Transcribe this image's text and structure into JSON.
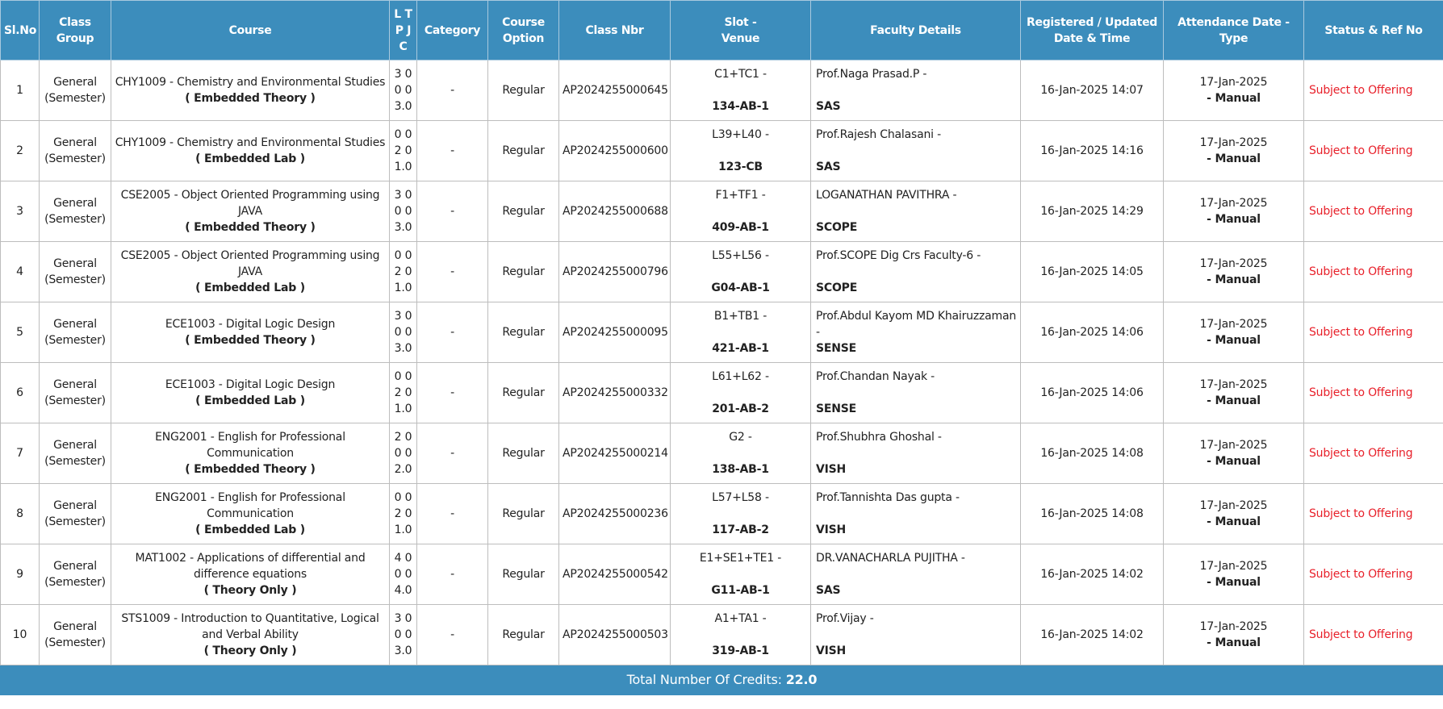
{
  "headers": {
    "slno": "Sl.No",
    "class_group_1": "Class",
    "class_group_2": "Group",
    "course": "Course",
    "ltpc_1": "L T",
    "ltpc_2": "P J",
    "ltpc_3": "C",
    "category": "Category",
    "course_option_1": "Course",
    "course_option_2": "Option",
    "class_nbr": "Class Nbr",
    "slot_venue_1": "Slot -",
    "slot_venue_2": "Venue",
    "faculty": "Faculty Details",
    "registered_1": "Registered / Updated",
    "registered_2": "Date & Time",
    "attendance": "Attendance Date - Type",
    "status": "Status & Ref No"
  },
  "rows": [
    {
      "sl": "1",
      "group1": "General",
      "group2": "(Semester)",
      "course": "CHY1009 - Chemistry and Environmental Studies",
      "course_type": "( Embedded Theory )",
      "ltpc": [
        "3 0",
        "0 0",
        "3.0"
      ],
      "category": "-",
      "option": "Regular",
      "class_nbr": "AP2024255000645",
      "slot": "C1+TC1 -",
      "venue": "134-AB-1",
      "faculty": "Prof.Naga Prasad.P -",
      "school": "SAS",
      "registered": "16-Jan-2025 14:07",
      "att_date": "17-Jan-2025",
      "att_type": "- Manual",
      "status": "Subject to Offering"
    },
    {
      "sl": "2",
      "group1": "General",
      "group2": "(Semester)",
      "course": "CHY1009 - Chemistry and Environmental Studies",
      "course_type": "( Embedded Lab )",
      "ltpc": [
        "0 0",
        "2 0",
        "1.0"
      ],
      "category": "-",
      "option": "Regular",
      "class_nbr": "AP2024255000600",
      "slot": "L39+L40 -",
      "venue": "123-CB",
      "faculty": "Prof.Rajesh Chalasani -",
      "school": "SAS",
      "registered": "16-Jan-2025 14:16",
      "att_date": "17-Jan-2025",
      "att_type": "- Manual",
      "status": "Subject to Offering"
    },
    {
      "sl": "3",
      "group1": "General",
      "group2": "(Semester)",
      "course": "CSE2005 - Object Oriented Programming using JAVA",
      "course_type": "( Embedded Theory )",
      "ltpc": [
        "3 0",
        "0 0",
        "3.0"
      ],
      "category": "-",
      "option": "Regular",
      "class_nbr": "AP2024255000688",
      "slot": "F1+TF1 -",
      "venue": "409-AB-1",
      "faculty": "LOGANATHAN PAVITHRA -",
      "school": "SCOPE",
      "registered": "16-Jan-2025 14:29",
      "att_date": "17-Jan-2025",
      "att_type": "- Manual",
      "status": "Subject to Offering"
    },
    {
      "sl": "4",
      "group1": "General",
      "group2": "(Semester)",
      "course": "CSE2005 - Object Oriented Programming using JAVA",
      "course_type": "( Embedded Lab )",
      "ltpc": [
        "0 0",
        "2 0",
        "1.0"
      ],
      "category": "-",
      "option": "Regular",
      "class_nbr": "AP2024255000796",
      "slot": "L55+L56 -",
      "venue": "G04-AB-1",
      "faculty": "Prof.SCOPE Dig Crs Faculty-6 -",
      "school": "SCOPE",
      "registered": "16-Jan-2025 14:05",
      "att_date": "17-Jan-2025",
      "att_type": "- Manual",
      "status": "Subject to Offering"
    },
    {
      "sl": "5",
      "group1": "General",
      "group2": "(Semester)",
      "course": "ECE1003 - Digital Logic Design",
      "course_type": "( Embedded Theory )",
      "ltpc": [
        "3 0",
        "0 0",
        "3.0"
      ],
      "category": "-",
      "option": "Regular",
      "class_nbr": "AP2024255000095",
      "slot": "B1+TB1 -",
      "venue": "421-AB-1",
      "faculty": "Prof.Abdul Kayom MD Khairuzzaman -",
      "school": "SENSE",
      "registered": "16-Jan-2025 14:06",
      "att_date": "17-Jan-2025",
      "att_type": "- Manual",
      "status": "Subject to Offering"
    },
    {
      "sl": "6",
      "group1": "General",
      "group2": "(Semester)",
      "course": "ECE1003 - Digital Logic Design",
      "course_type": "( Embedded Lab )",
      "ltpc": [
        "0 0",
        "2 0",
        "1.0"
      ],
      "category": "-",
      "option": "Regular",
      "class_nbr": "AP2024255000332",
      "slot": "L61+L62 -",
      "venue": "201-AB-2",
      "faculty": "Prof.Chandan Nayak -",
      "school": "SENSE",
      "registered": "16-Jan-2025 14:06",
      "att_date": "17-Jan-2025",
      "att_type": "- Manual",
      "status": "Subject to Offering"
    },
    {
      "sl": "7",
      "group1": "General",
      "group2": "(Semester)",
      "course": "ENG2001 - English for Professional Communication",
      "course_type": "( Embedded Theory )",
      "ltpc": [
        "2 0",
        "0 0",
        "2.0"
      ],
      "category": "-",
      "option": "Regular",
      "class_nbr": "AP2024255000214",
      "slot": "G2 -",
      "venue": "138-AB-1",
      "faculty": "Prof.Shubhra Ghoshal -",
      "school": "VISH",
      "registered": "16-Jan-2025 14:08",
      "att_date": "17-Jan-2025",
      "att_type": "- Manual",
      "status": "Subject to Offering"
    },
    {
      "sl": "8",
      "group1": "General",
      "group2": "(Semester)",
      "course": "ENG2001 - English for Professional Communication",
      "course_type": "( Embedded Lab )",
      "ltpc": [
        "0 0",
        "2 0",
        "1.0"
      ],
      "category": "-",
      "option": "Regular",
      "class_nbr": "AP2024255000236",
      "slot": "L57+L58 -",
      "venue": "117-AB-2",
      "faculty": "Prof.Tannishta Das gupta -",
      "school": "VISH",
      "registered": "16-Jan-2025 14:08",
      "att_date": "17-Jan-2025",
      "att_type": "- Manual",
      "status": "Subject to Offering"
    },
    {
      "sl": "9",
      "group1": "General",
      "group2": "(Semester)",
      "course": "MAT1002 - Applications of differential and difference equations",
      "course_type": "( Theory Only )",
      "ltpc": [
        "4 0",
        "0 0",
        "4.0"
      ],
      "category": "-",
      "option": "Regular",
      "class_nbr": "AP2024255000542",
      "slot": "E1+SE1+TE1 -",
      "venue": "G11-AB-1",
      "faculty": "DR.VANACHARLA PUJITHA -",
      "school": "SAS",
      "registered": "16-Jan-2025 14:02",
      "att_date": "17-Jan-2025",
      "att_type": "- Manual",
      "status": "Subject to Offering"
    },
    {
      "sl": "10",
      "group1": "General",
      "group2": "(Semester)",
      "course": "STS1009 - Introduction to Quantitative, Logical and Verbal Ability",
      "course_type": "( Theory Only )",
      "ltpc": [
        "3 0",
        "0 0",
        "3.0"
      ],
      "category": "-",
      "option": "Regular",
      "class_nbr": "AP2024255000503",
      "slot": "A1+TA1 -",
      "venue": "319-AB-1",
      "faculty": "Prof.Vijay -",
      "school": "VISH",
      "registered": "16-Jan-2025 14:02",
      "att_date": "17-Jan-2025",
      "att_type": "- Manual",
      "status": "Subject to Offering"
    }
  ],
  "footer": {
    "label": "Total Number Of Credits: ",
    "value": "22.0"
  },
  "colors": {
    "header_bg": "#3c8dbc",
    "status_text": "#e8202a"
  }
}
